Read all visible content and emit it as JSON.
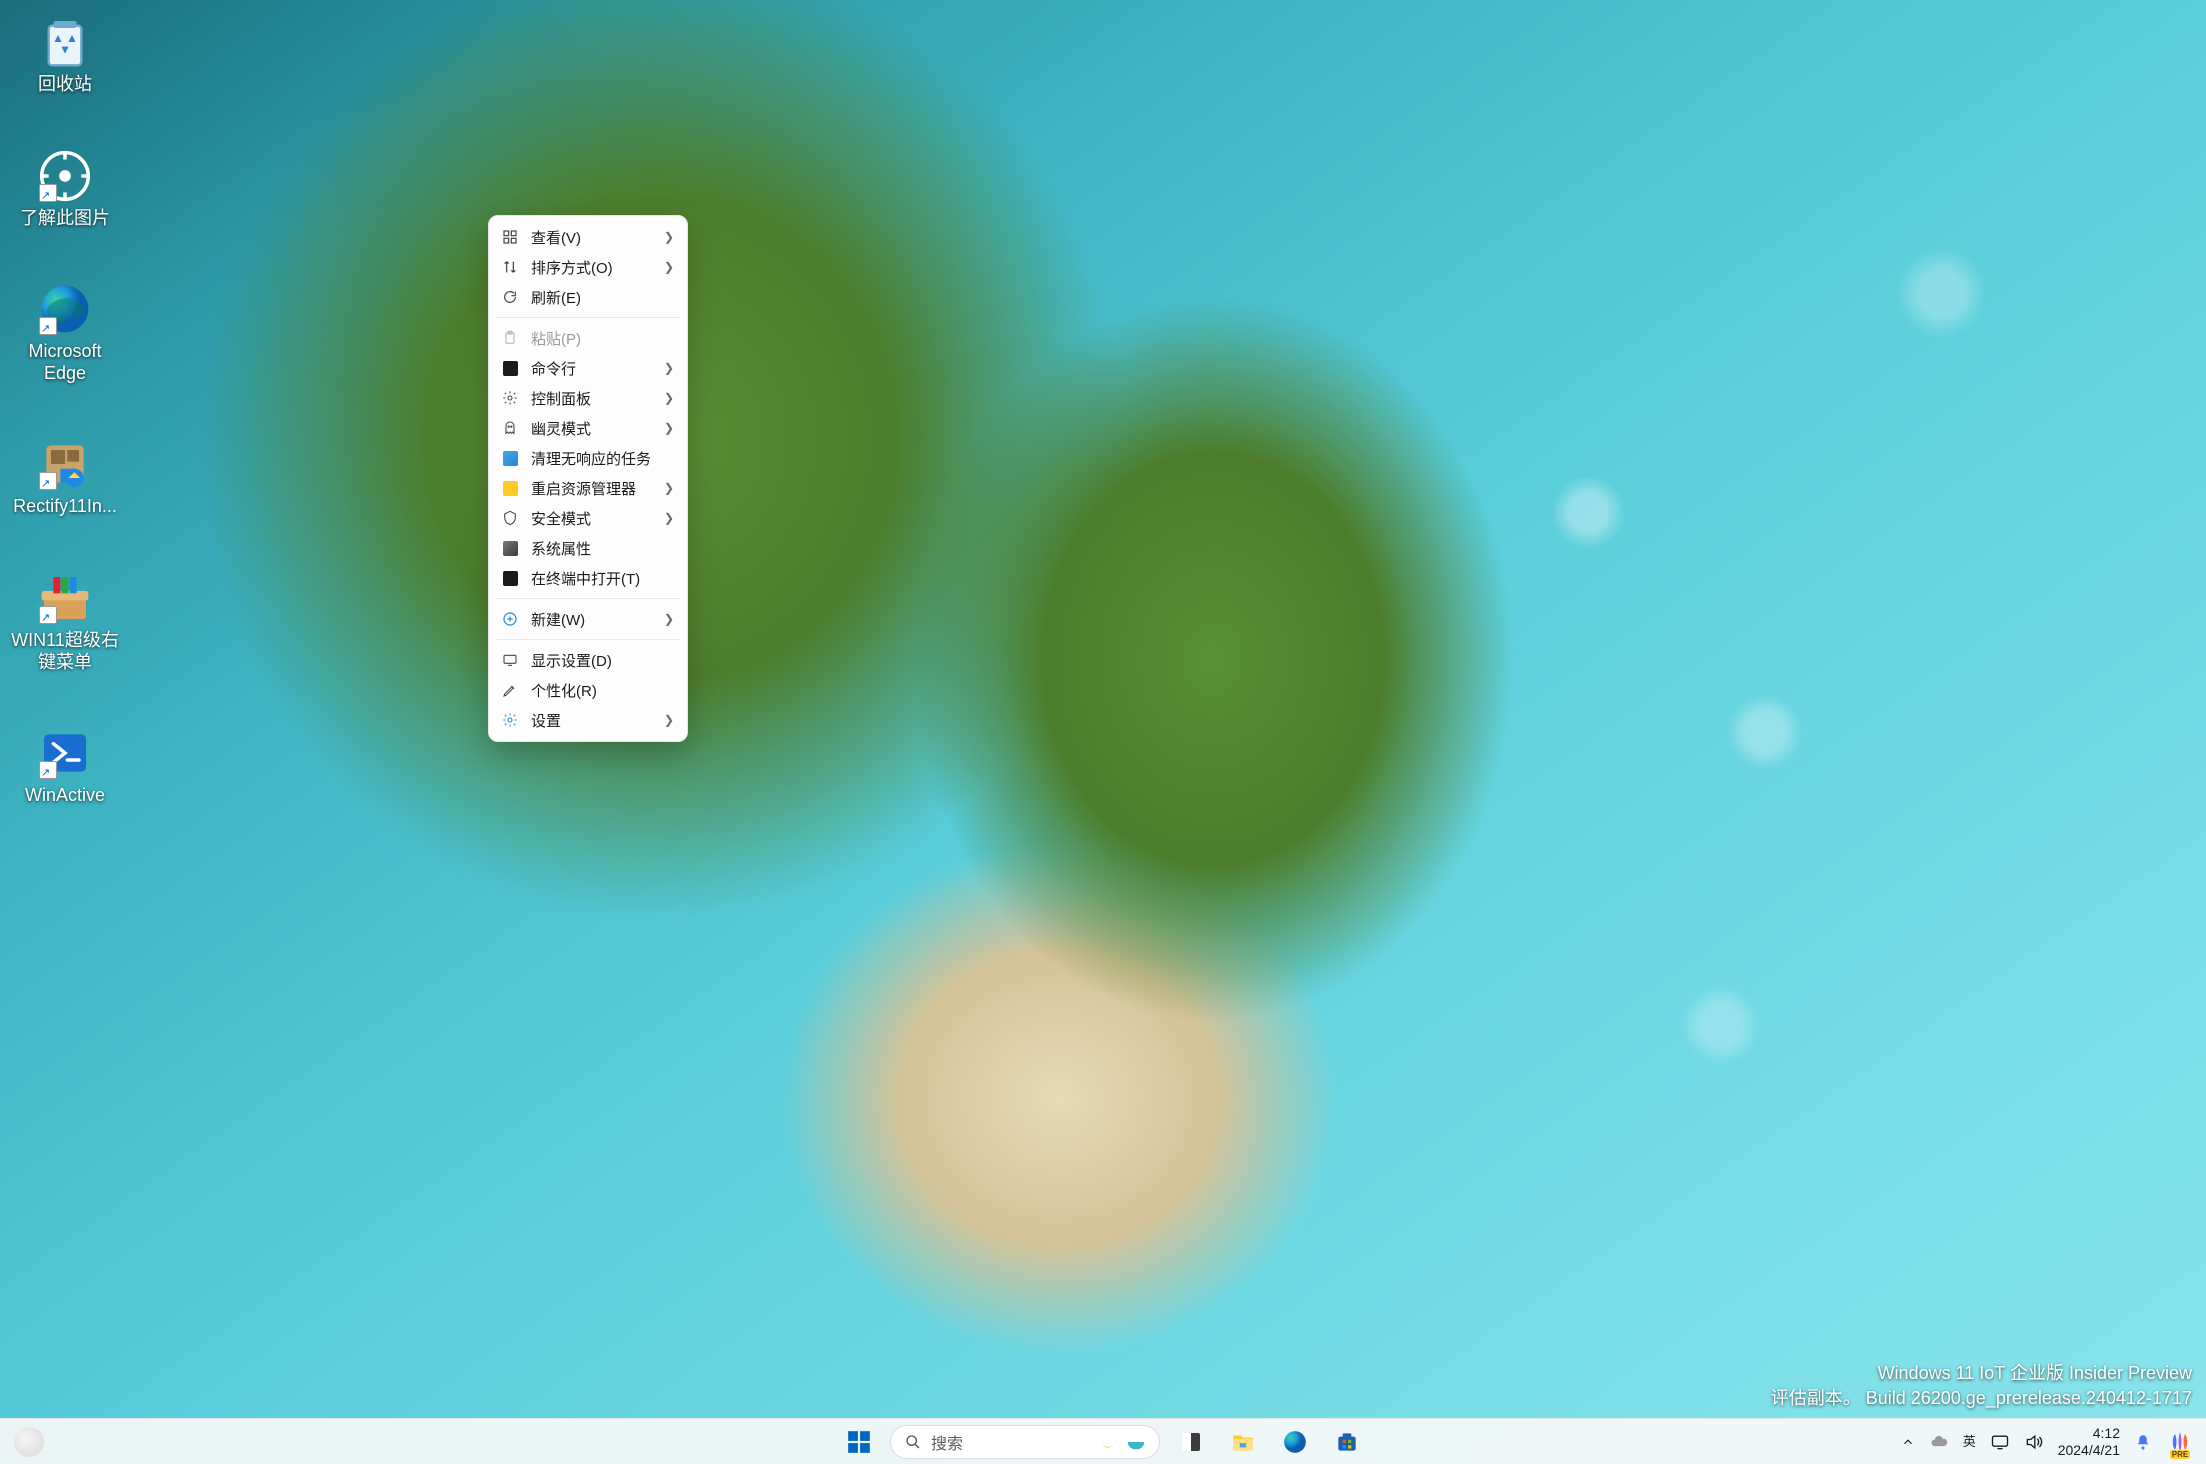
{
  "desktop_icons": [
    {
      "id": "recycle-bin",
      "label": "回收站"
    },
    {
      "id": "about-image",
      "label": "了解此图片"
    },
    {
      "id": "edge",
      "label": "Microsoft Edge"
    },
    {
      "id": "rectify11",
      "label": "Rectify11In..."
    },
    {
      "id": "win11-menu",
      "label": "WIN11超级右键菜单"
    },
    {
      "id": "winactive",
      "label": "WinActive"
    }
  ],
  "context_menu": {
    "groups": [
      [
        {
          "id": "view",
          "label": "查看(V)",
          "icon": "grid-icon",
          "submenu": true
        },
        {
          "id": "sort",
          "label": "排序方式(O)",
          "icon": "sort-icon",
          "submenu": true
        },
        {
          "id": "refresh",
          "label": "刷新(E)",
          "icon": "refresh-icon",
          "submenu": false
        }
      ],
      [
        {
          "id": "paste",
          "label": "粘贴(P)",
          "icon": "paste-icon",
          "submenu": false,
          "disabled": true
        },
        {
          "id": "cmd",
          "label": "命令行",
          "icon": "cmd-icon",
          "submenu": true
        },
        {
          "id": "cpl",
          "label": "控制面板",
          "icon": "gear-icon",
          "submenu": true
        },
        {
          "id": "ghost",
          "label": "幽灵模式",
          "icon": "ghost-icon",
          "submenu": true
        },
        {
          "id": "kill",
          "label": "清理无响应的任务",
          "icon": "cleanup-icon",
          "submenu": false
        },
        {
          "id": "restart-ex",
          "label": "重启资源管理器",
          "icon": "explorer-icon",
          "submenu": true
        },
        {
          "id": "safemode",
          "label": "安全模式",
          "icon": "safemode-icon",
          "submenu": true
        },
        {
          "id": "sysprops",
          "label": "系统属性",
          "icon": "sysprops-icon",
          "submenu": false
        },
        {
          "id": "terminal",
          "label": "在终端中打开(T)",
          "icon": "terminal-icon",
          "submenu": false
        }
      ],
      [
        {
          "id": "new",
          "label": "新建(W)",
          "icon": "new-icon",
          "submenu": true
        }
      ],
      [
        {
          "id": "display",
          "label": "显示设置(D)",
          "icon": "display-icon",
          "submenu": false
        },
        {
          "id": "personal",
          "label": "个性化(R)",
          "icon": "personalize-icon",
          "submenu": false
        },
        {
          "id": "settings",
          "label": "设置",
          "icon": "settings-icon",
          "submenu": true
        }
      ]
    ]
  },
  "watermark": {
    "line1": "Windows 11 IoT 企业版 Insider Preview",
    "line2": "评估副本。 Build 26200.ge_prerelease.240412-1717"
  },
  "taskbar": {
    "search_placeholder": "搜索",
    "ime_top": "英",
    "ime_bottom": "英",
    "time": "4:12",
    "date": "2024/4/21",
    "copilot_badge": "PRE"
  }
}
